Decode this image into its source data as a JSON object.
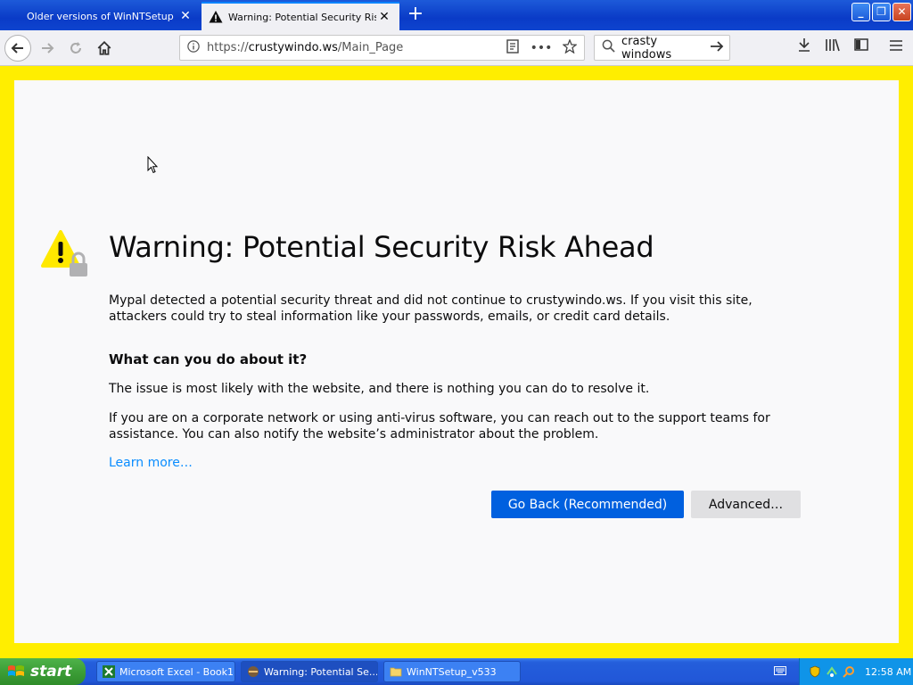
{
  "browser": {
    "tabs": [
      {
        "label": "Older versions of WinNTSetup (W",
        "close": "✕"
      },
      {
        "label": "Warning: Potential Security Risk A",
        "close": "✕"
      }
    ],
    "new_tab": "+",
    "window_buttons": {
      "minimize": "_",
      "restore": "❐",
      "close": "✕"
    },
    "url_prefix": "https://",
    "url_host": "crustywindo.ws",
    "url_path": "/Main_Page",
    "search_value": "crasty windows"
  },
  "page": {
    "title": "Warning: Potential Security Risk Ahead",
    "intro": "Mypal detected a potential security threat and did not continue to crustywindo.ws. If you visit this site, attackers could try to steal information like your passwords, emails, or credit card details.",
    "question": "What can you do about it?",
    "para1": "The issue is most likely with the website, and there is nothing you can do to resolve it.",
    "para2": "If you are on a corporate network or using anti-virus software, you can reach out to the support teams for assistance. You can also notify the website’s administrator about the problem.",
    "learn_more": "Learn more…",
    "go_back": "Go Back (Recommended)",
    "advanced": "Advanced…"
  },
  "taskbar": {
    "start": "start",
    "tasks": [
      {
        "label": "Microsoft Excel - Book1"
      },
      {
        "label": "Warning: Potential Se..."
      },
      {
        "label": "WinNTSetup_v533"
      }
    ],
    "clock": "12:58 AM"
  },
  "colors": {
    "frame": "#ffee00",
    "primary_button": "#0060df",
    "link": "#0a8dff"
  }
}
